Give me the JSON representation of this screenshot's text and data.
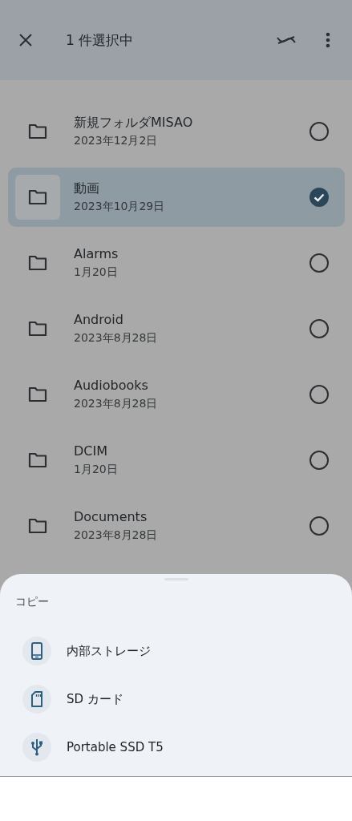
{
  "toolbar": {
    "title": "1 件選択中"
  },
  "folders": [
    {
      "name": "新規フォルダMISAO",
      "date": "2023年12月2日",
      "selected": false
    },
    {
      "name": "動画",
      "date": "2023年10月29日",
      "selected": true
    },
    {
      "name": "Alarms",
      "date": "1月20日",
      "selected": false
    },
    {
      "name": "Android",
      "date": "2023年8月28日",
      "selected": false
    },
    {
      "name": "Audiobooks",
      "date": "2023年8月28日",
      "selected": false
    },
    {
      "name": "DCIM",
      "date": "1月20日",
      "selected": false
    },
    {
      "name": "Documents",
      "date": "2023年8月28日",
      "selected": false
    }
  ],
  "sheet": {
    "title": "コピー",
    "items": [
      {
        "kind": "phone",
        "label": "内部ストレージ"
      },
      {
        "kind": "sdcard",
        "label": "SD カード"
      },
      {
        "kind": "usb",
        "label": "Portable SSD T5"
      }
    ]
  }
}
